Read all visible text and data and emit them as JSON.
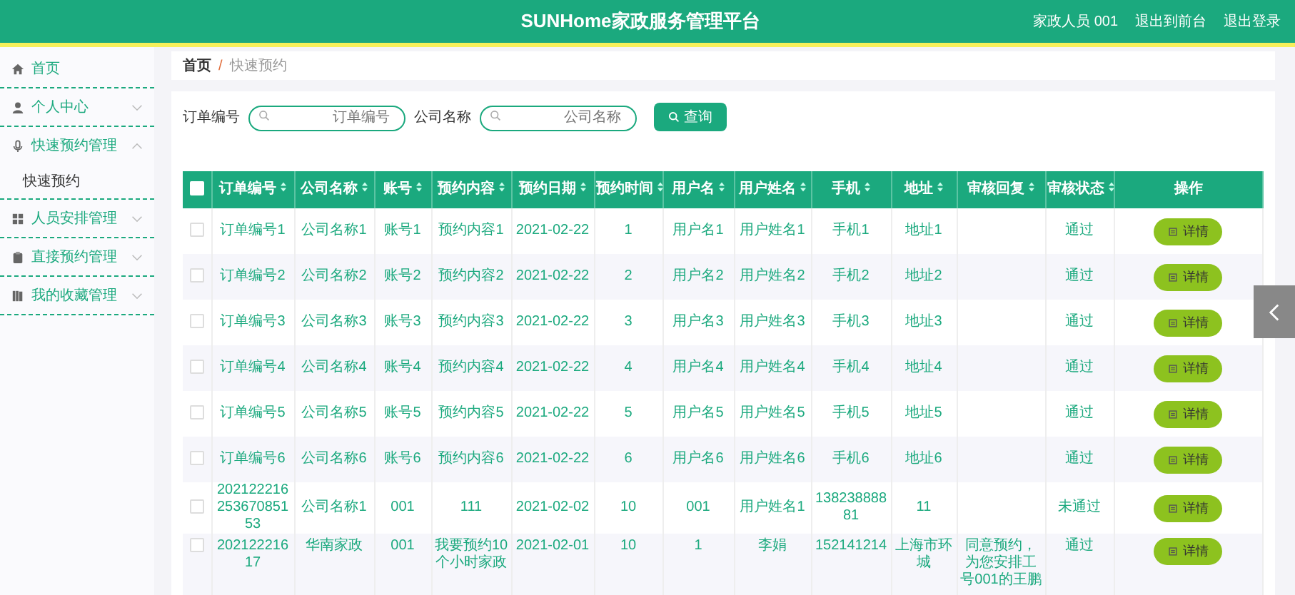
{
  "header": {
    "title": "SUNHome家政服务管理平台",
    "user": "家政人员 001",
    "links": [
      "退出到前台",
      "退出登录"
    ]
  },
  "sidebar": {
    "items": [
      {
        "label": "首页",
        "expandable": false,
        "expanded": false
      },
      {
        "label": "个人中心",
        "expandable": true,
        "expanded": false
      },
      {
        "label": "快速预约管理",
        "expandable": true,
        "expanded": true,
        "children": [
          {
            "label": "快速预约"
          }
        ]
      },
      {
        "label": "人员安排管理",
        "expandable": true,
        "expanded": false
      },
      {
        "label": "直接预约管理",
        "expandable": true,
        "expanded": false
      },
      {
        "label": "我的收藏管理",
        "expandable": true,
        "expanded": false
      }
    ]
  },
  "breadcrumb": {
    "items": [
      "首页",
      "快速预约"
    ],
    "separator": "/"
  },
  "search": {
    "fields": [
      {
        "label": "订单编号",
        "placeholder": "订单编号"
      },
      {
        "label": "公司名称",
        "placeholder": "公司名称"
      }
    ],
    "button": "查询"
  },
  "table": {
    "all_checked": false,
    "columns": [
      "订单编号",
      "公司名称",
      "账号",
      "预约内容",
      "预约日期",
      "预约时间",
      "用户名",
      "用户姓名",
      "手机",
      "地址",
      "审核回复",
      "审核状态",
      "操作"
    ],
    "rows": [
      {
        "checked": false,
        "cells": [
          "订单编号1",
          "公司名称1",
          "账号1",
          "预约内容1",
          "2021-02-22",
          "1",
          "用户名1",
          "用户姓名1",
          "手机1",
          "地址1",
          "",
          "通过"
        ],
        "action": "详情"
      },
      {
        "checked": false,
        "cells": [
          "订单编号2",
          "公司名称2",
          "账号2",
          "预约内容2",
          "2021-02-22",
          "2",
          "用户名2",
          "用户姓名2",
          "手机2",
          "地址2",
          "",
          "通过"
        ],
        "action": "详情"
      },
      {
        "checked": false,
        "cells": [
          "订单编号3",
          "公司名称3",
          "账号3",
          "预约内容3",
          "2021-02-22",
          "3",
          "用户名3",
          "用户姓名3",
          "手机3",
          "地址3",
          "",
          "通过"
        ],
        "action": "详情"
      },
      {
        "checked": false,
        "cells": [
          "订单编号4",
          "公司名称4",
          "账号4",
          "预约内容4",
          "2021-02-22",
          "4",
          "用户名4",
          "用户姓名4",
          "手机4",
          "地址4",
          "",
          "通过"
        ],
        "action": "详情"
      },
      {
        "checked": false,
        "cells": [
          "订单编号5",
          "公司名称5",
          "账号5",
          "预约内容5",
          "2021-02-22",
          "5",
          "用户名5",
          "用户姓名5",
          "手机5",
          "地址5",
          "",
          "通过"
        ],
        "action": "详情"
      },
      {
        "checked": false,
        "cells": [
          "订单编号6",
          "公司名称6",
          "账号6",
          "预约内容6",
          "2021-02-22",
          "6",
          "用户名6",
          "用户姓名6",
          "手机6",
          "地址6",
          "",
          "通过"
        ],
        "action": "详情"
      },
      {
        "checked": false,
        "cells": [
          "20212221625367085153",
          "公司名称1",
          "001",
          "111",
          "2021-02-02",
          "10",
          "001",
          "用户姓名1",
          "13823888881",
          "11",
          "",
          "未通过"
        ],
        "action": "详情"
      },
      {
        "checked": false,
        "cells": [
          "20212221617",
          "华南家政",
          "001",
          "我要预约10个小时家政",
          "2021-02-01",
          "10",
          "1",
          "李娟",
          "152141214",
          "上海市环城",
          "同意预约，为您安排工号001的王鹏",
          "通过"
        ],
        "action": "详情"
      }
    ]
  }
}
